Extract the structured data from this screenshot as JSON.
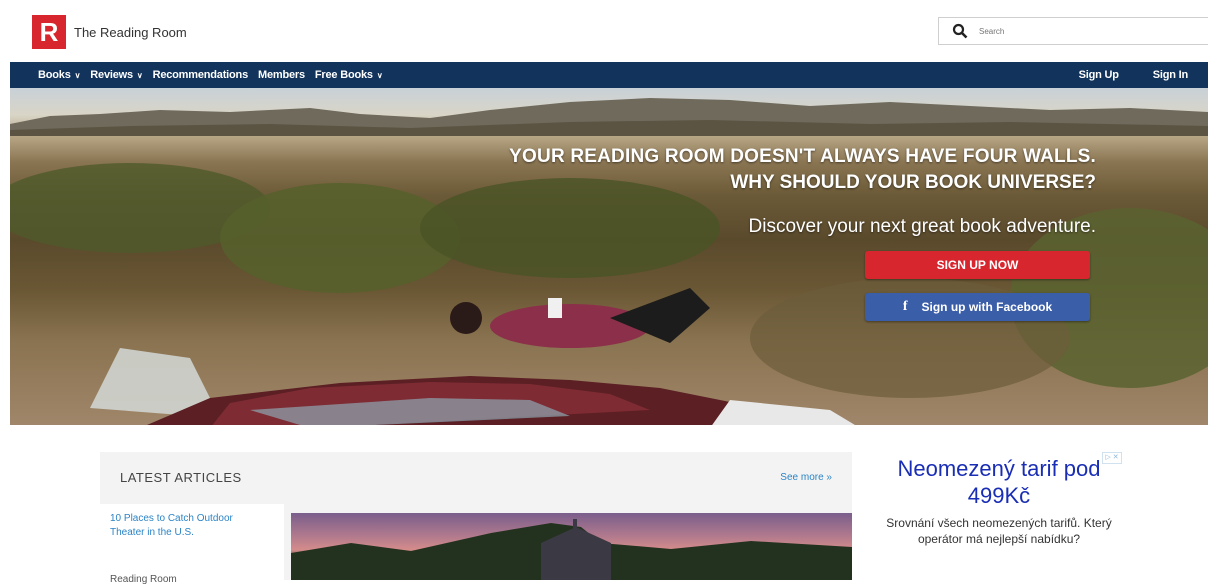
{
  "header": {
    "logo_letter": "R",
    "brand": "The Reading Room",
    "search_placeholder": "Search"
  },
  "nav": {
    "items": [
      {
        "label": "Books",
        "has_dropdown": true
      },
      {
        "label": "Reviews",
        "has_dropdown": true
      },
      {
        "label": "Recommendations",
        "has_dropdown": false
      },
      {
        "label": "Members",
        "has_dropdown": false
      },
      {
        "label": "Free Books",
        "has_dropdown": true
      }
    ],
    "sign_up": "Sign Up",
    "sign_in": "Sign In"
  },
  "hero": {
    "headline_1": "YOUR READING ROOM DOESN'T ALWAYS HAVE FOUR WALLS.",
    "headline_2": "WHY SHOULD YOUR BOOK UNIVERSE?",
    "subhead": "Discover your next great book adventure.",
    "cta_signup": "SIGN UP NOW",
    "cta_facebook": "Sign up with Facebook"
  },
  "articles": {
    "title": "LATEST ARTICLES",
    "see_more": "See more »",
    "items": [
      {
        "title": "10 Places to Catch Outdoor Theater in the U.S."
      },
      {
        "title": "Reading Room"
      }
    ]
  },
  "ad": {
    "title": "Neomezený tarif pod 499Kč",
    "body": "Srovnání všech neomezených tarifů. Který operátor má nejlepší nabídku?",
    "choices_label": "▷ ✕"
  },
  "colors": {
    "brand_red": "#d8262f",
    "nav_blue": "#12335c",
    "facebook_blue": "#3b5ea8",
    "link_blue": "#2b84c6",
    "ad_title_blue": "#1a2eb5"
  }
}
